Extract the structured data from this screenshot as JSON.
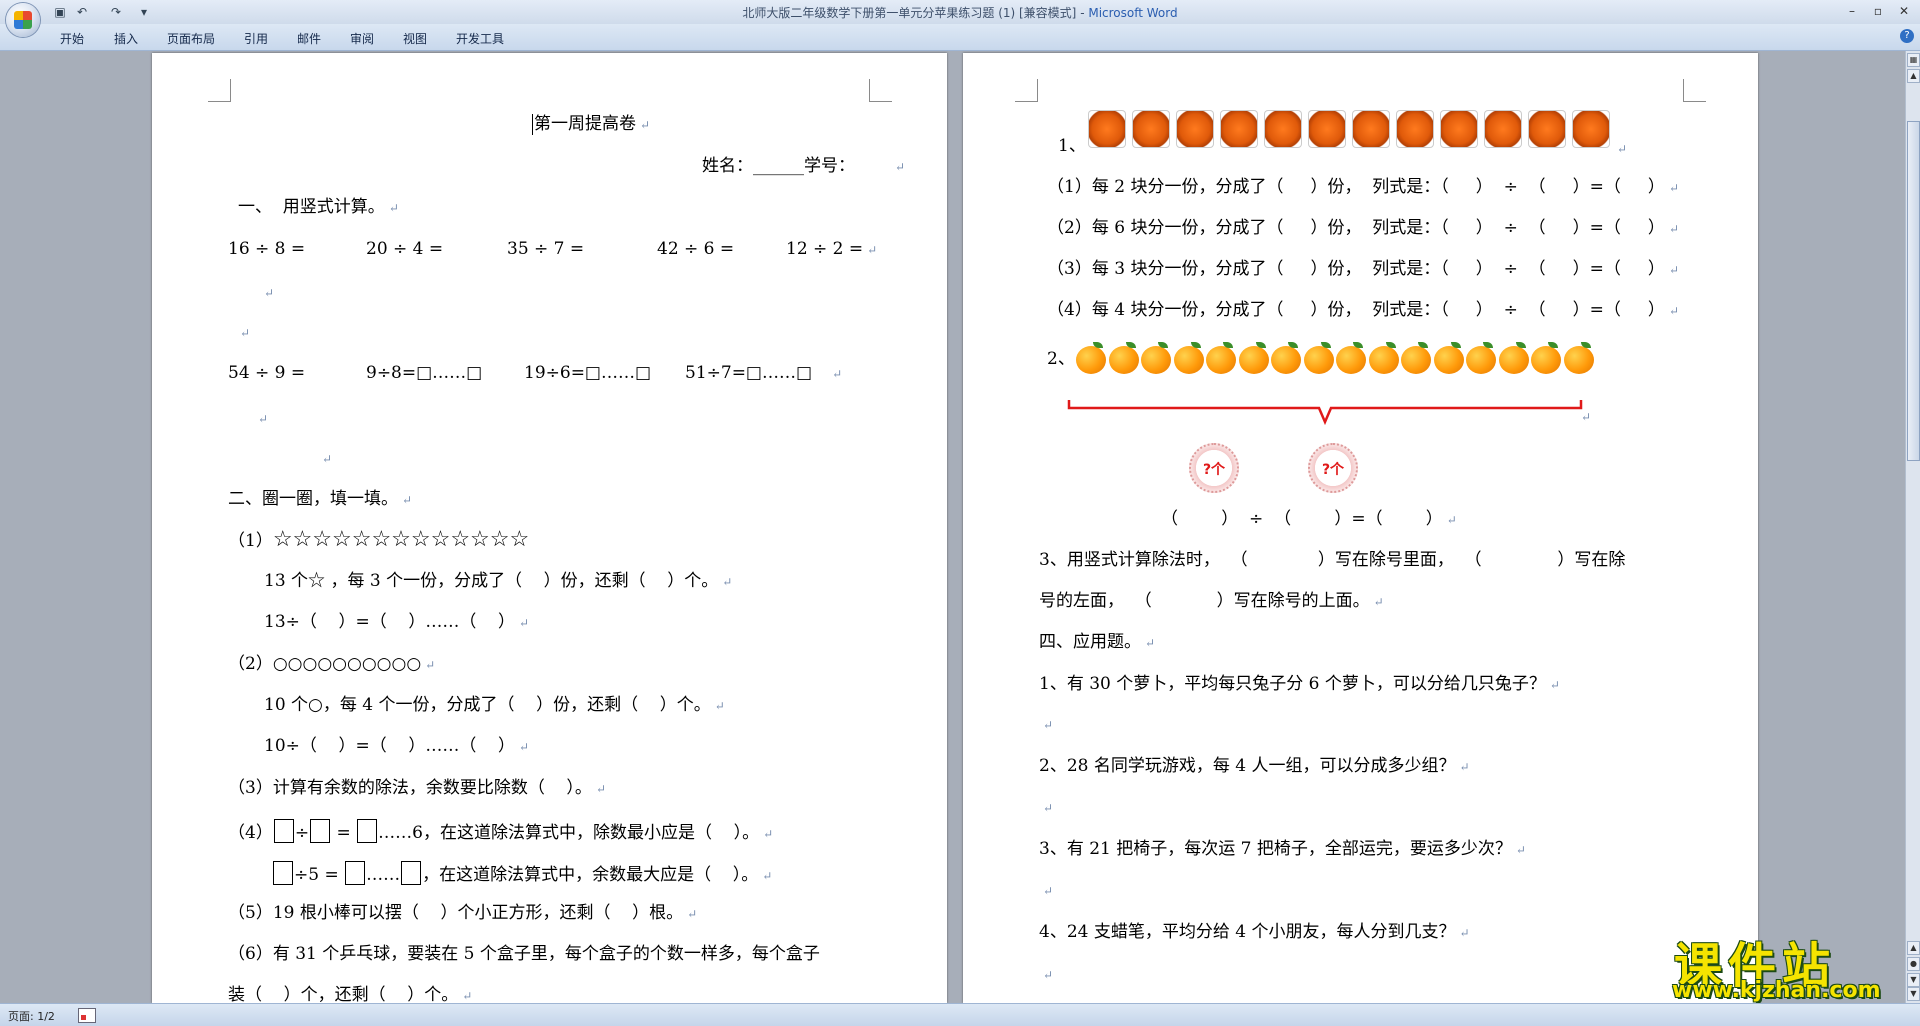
{
  "window": {
    "title": "北师大版二年级数学下册第一单元分苹果练习题 (1) [兼容模式]",
    "title_sep": " - ",
    "app_name": "Microsoft Word",
    "quick_access": [
      "save-icon",
      "undo-icon",
      "redo-icon",
      "customize-icon"
    ]
  },
  "ribbon": {
    "tabs": [
      "开始",
      "插入",
      "页面布局",
      "引用",
      "邮件",
      "审阅",
      "视图",
      "开发工具"
    ]
  },
  "status": {
    "page": "页面: 1/2"
  },
  "page1": {
    "title": "第一周提高卷",
    "name_line": "姓名：______学号：",
    "s1_heading": "一、  用竖式计算。",
    "calc_row1": [
      "16 ÷ 8 =",
      "20 ÷ 4 =",
      "35 ÷ 7 =",
      "42 ÷ 6 =",
      "12 ÷ 2 ="
    ],
    "calc_row2": [
      "54 ÷ 9 =",
      "9÷8=□……□",
      "19÷6=□……□",
      "51÷7=□……□"
    ],
    "s2_heading": "二、圈一圈，填一填。",
    "q1_label": "（1）",
    "q1_stars": "☆☆☆☆☆☆☆☆☆☆☆☆☆",
    "q1_text1": "13 个☆ ，每 3 个一份，分成了（    ）份，还剩（    ）个。",
    "q1_text2": "13÷（    ）=（    ）……（    ）",
    "q2_label": "（2）",
    "q2_circles": "○○○○○○○○○○",
    "q2_text1": "10 个○，每 4 个一份，分成了（    ）份，还剩（    ）个。",
    "q2_text2": "10÷（    ）=（    ）……（    ）",
    "q3": "（3）计算有余数的除法，余数要比除数（    ）。",
    "q4_label": "（4）",
    "q4_div": "÷",
    "q4_eq": " = ",
    "q4_rem": "……6，在这道除法算式中，除数最小应是（    ）。",
    "q4b_mid": "÷5 = ",
    "q4b_dots": "……",
    "q4b_text": "，在这道除法算式中，余数最大应是（    ）。",
    "q5": "（5）19 根小棒可以摆（    ）个小正方形，还剩（    ）根。",
    "q6_line1": "（6）有 31 个乒乓球，要装在 5 个盒子里，每个盒子的个数一样多，每个盒子",
    "q6_line2": "装（    ）个，还剩（    ）个。"
  },
  "page2": {
    "p1_label": "1、",
    "p1_fruit_count": 12,
    "p1_lines": [
      "（1）每 2 块分一份，分成了（     ）份，  列式是：（     ）  ÷  （     ）=（     ）",
      "（2）每 6 块分一份，分成了（     ）份，  列式是：（     ）  ÷  （     ）=（     ）",
      "（3）每 3 块分一份，分成了（     ）份，  列式是：（     ）  ÷  （     ）=（     ）",
      "（4）每 4 块分一份，分成了（     ）份，  列式是：（     ）  ÷  （     ）=（     ）"
    ],
    "p2_label": "2、",
    "p2_orange_count": 16,
    "p2_circle_label": "?个",
    "p2_equation": "（        ）  ÷  （        ）=（        ）",
    "p3_line1": "3、用竖式计算除法时，  （             ）写在除号里面，  （              ）写在除",
    "p3_line2": "号的左面，  （            ）写在除号的上面。",
    "s4_heading": "四、应用题。",
    "app_q": [
      "1、有 30 个萝卜，平均每只兔子分 6 个萝卜，可以分给几只兔子？",
      "2、28 名同学玩游戏，每 4 人一组，可以分成多少组？",
      "3、有 21 把椅子，每次运 7 把椅子，全部运完，要运多少次？",
      "4、24 支蜡笔，平均分给 4 个小朋友，每人分到几支？"
    ]
  },
  "watermark": {
    "zh": "课件站",
    "en": "www.kjzhan.com"
  },
  "colors": {
    "title_app": "#2a5db0",
    "brace": "#e01919",
    "watermark": "#f5e400"
  }
}
